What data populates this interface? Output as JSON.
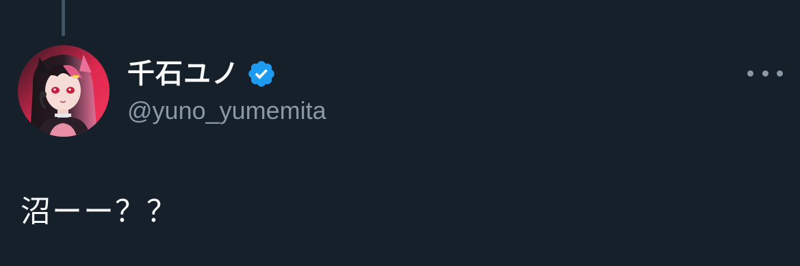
{
  "author": {
    "display_name": "千石ユノ",
    "handle": "@yuno_yumemita",
    "verified": true,
    "avatar_icon": "avatar-illustration"
  },
  "tweet": {
    "text": "沼ーー？？"
  },
  "actions": {
    "more_icon": "more-options-icon"
  },
  "colors": {
    "background": "#15202b",
    "primary_text": "#f7f9f9",
    "secondary_text": "#8b98a5",
    "verified_badge": "#1d9bf0",
    "thread_line": "#425364"
  }
}
